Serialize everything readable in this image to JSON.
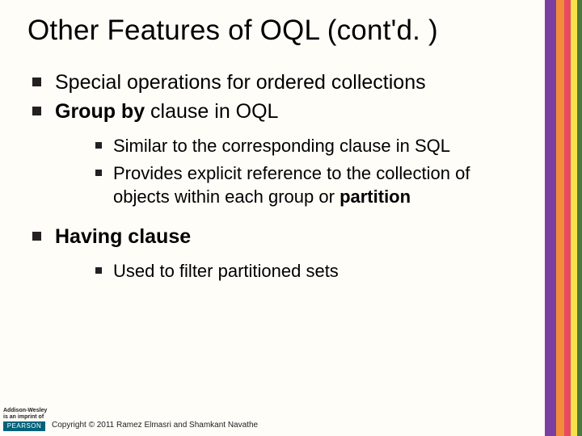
{
  "title": "Other Features of OQL (cont'd. )",
  "bullets": {
    "b1": "Special operations for ordered collections",
    "b2_pre": "Group by",
    "b2_post": " clause in OQL",
    "b2a": "Similar to the corresponding clause in SQL",
    "b2b_pre": "Provides explicit reference to the collection of objects within each group or ",
    "b2b_bold": "partition",
    "b3": "Having clause",
    "b3a": "Used to filter partitioned sets"
  },
  "footer": {
    "aw1": "Addison-Wesley",
    "aw2": "is an imprint of",
    "pearson": "PEARSON",
    "copyright": "Copyright © 2011 Ramez Elmasri and Shamkant Navathe"
  }
}
